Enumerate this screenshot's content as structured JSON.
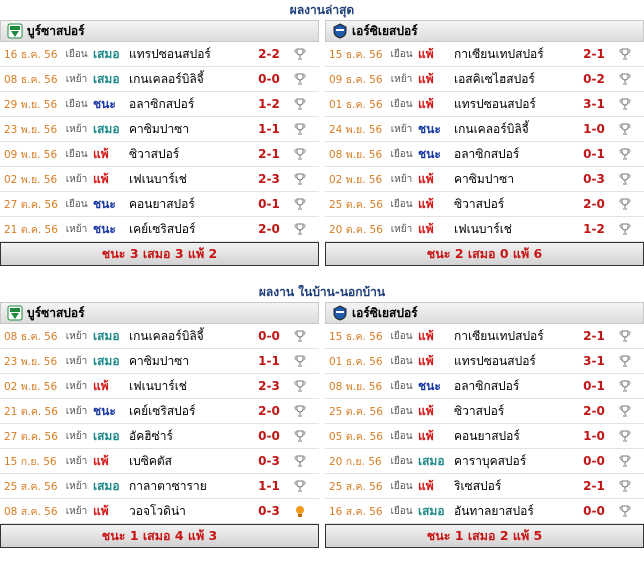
{
  "section1": {
    "title": "ผลงานล่าสุด"
  },
  "section2": {
    "title": "ผลงาน ในบ้าน-นอกบ้าน"
  },
  "teams": {
    "left": "บูร์ซาสปอร์",
    "right": "เอร์ซิเยสปอร์"
  },
  "recent": {
    "left": [
      {
        "date": "16 ธ.ค. 56",
        "ha": "เยือน",
        "res": "เสมอ",
        "rc": "d2",
        "opp": "แทรปซอนสปอร์",
        "score": "2-2"
      },
      {
        "date": "08 ธ.ค. 56",
        "ha": "เหย้า",
        "res": "เสมอ",
        "rc": "d2",
        "opp": "เกนเคลอร์บิลิจี้",
        "score": "0-0"
      },
      {
        "date": "29 พ.ย. 56",
        "ha": "เยือน",
        "res": "ชนะ",
        "rc": "w",
        "opp": "อลาซิกสปอร์",
        "score": "1-2"
      },
      {
        "date": "23 พ.ย. 56",
        "ha": "เหย้า",
        "res": "เสมอ",
        "rc": "d2",
        "opp": "คาซิมปาซา",
        "score": "1-1"
      },
      {
        "date": "09 พ.ย. 56",
        "ha": "เยือน",
        "res": "แพ้",
        "rc": "l",
        "opp": "ซิวาสปอร์",
        "score": "2-1"
      },
      {
        "date": "02 พ.ย. 56",
        "ha": "เหย้า",
        "res": "แพ้",
        "rc": "l",
        "opp": "เฟเนบาร์เช่",
        "score": "2-3"
      },
      {
        "date": "27 ต.ค. 56",
        "ha": "เยือน",
        "res": "ชนะ",
        "rc": "w",
        "opp": "คอนยาสปอร์",
        "score": "0-1"
      },
      {
        "date": "21 ต.ค. 56",
        "ha": "เหย้า",
        "res": "ชนะ",
        "rc": "w",
        "opp": "เคย์เซริสปอร์",
        "score": "2-0"
      }
    ],
    "right": [
      {
        "date": "15 ธ.ค. 56",
        "ha": "เยือน",
        "res": "แพ้",
        "rc": "l",
        "opp": "กาเซียนเทปสปอร์",
        "score": "2-1"
      },
      {
        "date": "09 ธ.ค. 56",
        "ha": "เหย้า",
        "res": "แพ้",
        "rc": "l",
        "opp": "เอสคิเซไฮสปอร์",
        "score": "0-2"
      },
      {
        "date": "01 ธ.ค. 56",
        "ha": "เยือน",
        "res": "แพ้",
        "rc": "l",
        "opp": "แทรปซอนสปอร์",
        "score": "3-1"
      },
      {
        "date": "24 พ.ย. 56",
        "ha": "เหย้า",
        "res": "ชนะ",
        "rc": "w",
        "opp": "เกนเคลอร์บิลิจี้",
        "score": "1-0"
      },
      {
        "date": "08 พ.ย. 56",
        "ha": "เยือน",
        "res": "ชนะ",
        "rc": "w",
        "opp": "อลาซิกสปอร์",
        "score": "0-1"
      },
      {
        "date": "02 พ.ย. 56",
        "ha": "เหย้า",
        "res": "แพ้",
        "rc": "l",
        "opp": "คาซิมปาซา",
        "score": "0-3"
      },
      {
        "date": "25 ต.ค. 56",
        "ha": "เยือน",
        "res": "แพ้",
        "rc": "l",
        "opp": "ซิวาสปอร์",
        "score": "2-0"
      },
      {
        "date": "20 ต.ค. 56",
        "ha": "เหย้า",
        "res": "แพ้",
        "rc": "l",
        "opp": "เฟเนบาร์เช่",
        "score": "1-2"
      }
    ],
    "summary_left": "ชนะ 3 เสมอ 3 แพ้ 2",
    "summary_right": "ชนะ 2 เสมอ 0 แพ้ 6"
  },
  "homeaway": {
    "left": [
      {
        "date": "08 ธ.ค. 56",
        "ha": "เหย้า",
        "res": "เสมอ",
        "rc": "d2",
        "opp": "เกนเคลอร์บิลิจี้",
        "score": "0-0"
      },
      {
        "date": "23 พ.ย. 56",
        "ha": "เหย้า",
        "res": "เสมอ",
        "rc": "d2",
        "opp": "คาซิมปาซา",
        "score": "1-1"
      },
      {
        "date": "02 พ.ย. 56",
        "ha": "เหย้า",
        "res": "แพ้",
        "rc": "l",
        "opp": "เฟเนบาร์เช่",
        "score": "2-3"
      },
      {
        "date": "21 ต.ค. 56",
        "ha": "เหย้า",
        "res": "ชนะ",
        "rc": "w",
        "opp": "เคย์เซริสปอร์",
        "score": "2-0"
      },
      {
        "date": "27 ต.ค. 56",
        "ha": "เหย้า",
        "res": "เสมอ",
        "rc": "d2",
        "opp": "อัคฮิซ่าร์",
        "score": "0-0"
      },
      {
        "date": "15 ก.ย. 56",
        "ha": "เหย้า",
        "res": "แพ้",
        "rc": "l",
        "opp": "เบซิคตัส",
        "score": "0-3"
      },
      {
        "date": "25 ส.ค. 56",
        "ha": "เหย้า",
        "res": "เสมอ",
        "rc": "d2",
        "opp": "กาลาตาซาราย",
        "score": "1-1"
      },
      {
        "date": "08 ส.ค. 56",
        "ha": "เหย้า",
        "res": "แพ้",
        "rc": "l",
        "opp": "วอจโวดิน่า",
        "score": "0-3",
        "icon": "europa"
      }
    ],
    "right": [
      {
        "date": "15 ธ.ค. 56",
        "ha": "เยือน",
        "res": "แพ้",
        "rc": "l",
        "opp": "กาเซียนเทปสปอร์",
        "score": "2-1"
      },
      {
        "date": "01 ธ.ค. 56",
        "ha": "เยือน",
        "res": "แพ้",
        "rc": "l",
        "opp": "แทรปซอนสปอร์",
        "score": "3-1"
      },
      {
        "date": "08 พ.ย. 56",
        "ha": "เยือน",
        "res": "ชนะ",
        "rc": "w",
        "opp": "อลาซิกสปอร์",
        "score": "0-1"
      },
      {
        "date": "25 ต.ค. 56",
        "ha": "เยือน",
        "res": "แพ้",
        "rc": "l",
        "opp": "ซิวาสปอร์",
        "score": "2-0"
      },
      {
        "date": "05 ต.ค. 56",
        "ha": "เยือน",
        "res": "แพ้",
        "rc": "l",
        "opp": "คอนยาสปอร์",
        "score": "1-0"
      },
      {
        "date": "20 ก.ย. 56",
        "ha": "เยือน",
        "res": "เสมอ",
        "rc": "d2",
        "opp": "คาราบุคสปอร์",
        "score": "0-0"
      },
      {
        "date": "25 ส.ค. 56",
        "ha": "เยือน",
        "res": "แพ้",
        "rc": "l",
        "opp": "ริเซสปอร์",
        "score": "2-1"
      },
      {
        "date": "16 ส.ค. 56",
        "ha": "เยือน",
        "res": "เสมอ",
        "rc": "d2",
        "opp": "อันทาลยาสปอร์",
        "score": "0-0"
      }
    ],
    "summary_left": "ชนะ 1 เสมอ 4 แพ้ 3",
    "summary_right": "ชนะ 1 เสมอ 2 แพ้ 5"
  }
}
